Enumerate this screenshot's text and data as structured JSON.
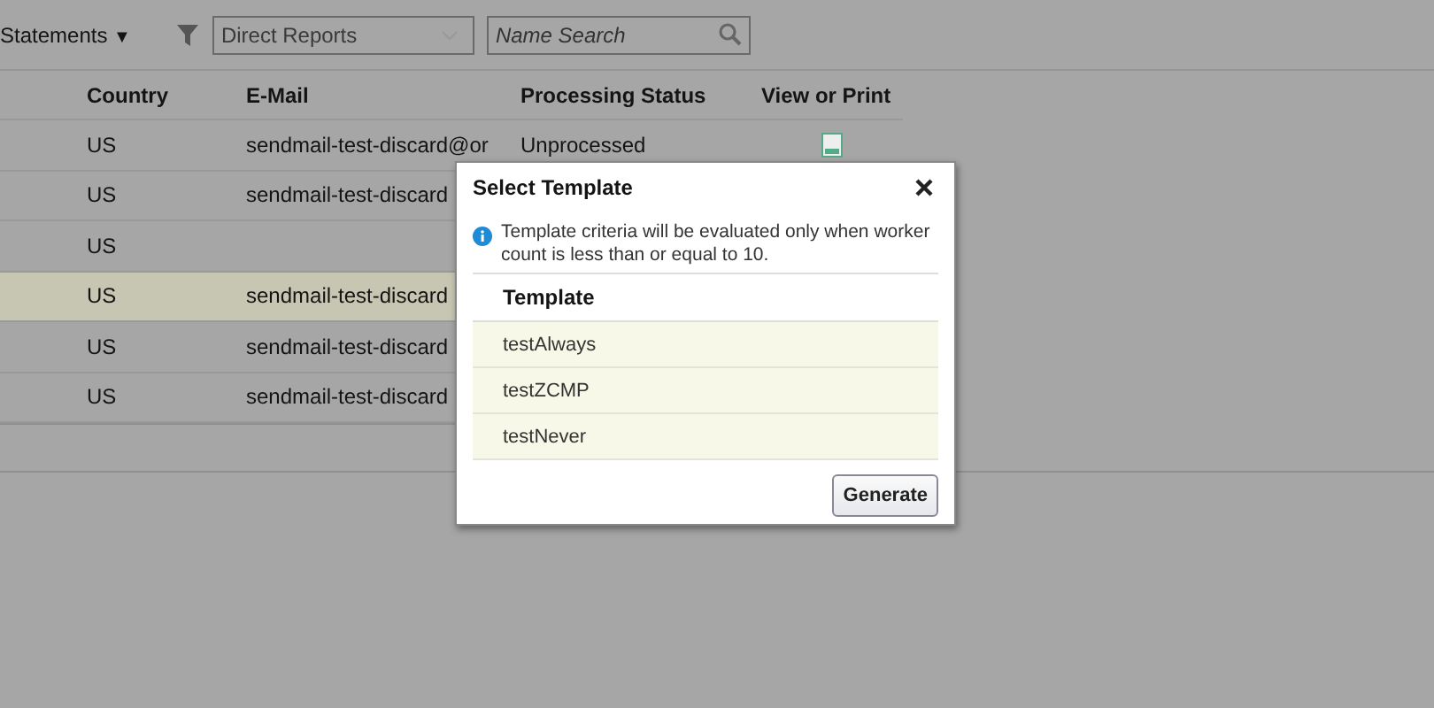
{
  "toolbar": {
    "view_menu": "Statements",
    "view_caret": "▼",
    "dropdown": {
      "value": "Direct Reports"
    },
    "search": {
      "placeholder": "Name Search"
    }
  },
  "table": {
    "columns": [
      "Country",
      "E-Mail",
      "Processing Status",
      "View or Print"
    ],
    "rows": [
      {
        "country": "US",
        "email": "sendmail-test-discard@or",
        "status": "Unprocessed",
        "view_icon": true,
        "selected": false
      },
      {
        "country": "US",
        "email": "sendmail-test-discard",
        "status": "",
        "selected": false
      },
      {
        "country": "US",
        "email": "",
        "status": "",
        "selected": false
      },
      {
        "country": "US",
        "email": "sendmail-test-discard",
        "status": "",
        "selected": true
      },
      {
        "country": "US",
        "email": "sendmail-test-discard",
        "status": "",
        "selected": false
      },
      {
        "country": "US",
        "email": "sendmail-test-discard",
        "status": "",
        "selected": false
      }
    ]
  },
  "dialog": {
    "title": "Select Template",
    "info": "Template criteria will be evaluated only when worker count is less than or equal to 10.",
    "column": "Template",
    "templates": [
      "testAlways",
      "testZCMP",
      "testNever"
    ],
    "button": "Generate"
  }
}
